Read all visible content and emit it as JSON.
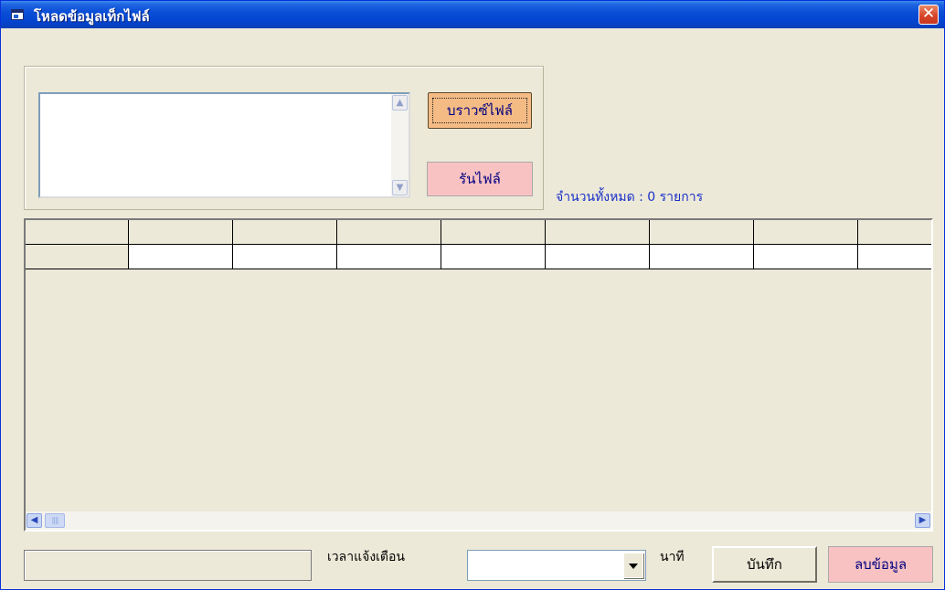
{
  "window": {
    "title": "โหลดข้อมูลเท็กไฟล์",
    "close_glyph": "✕",
    "title_icon": "form-icon"
  },
  "file_panel": {
    "file_text_value": "",
    "scroll_up_glyph": "▲",
    "scroll_down_glyph": "▼",
    "browse_label": "บราวซ์ไฟล์",
    "run_label": "รันไฟล์"
  },
  "summary": {
    "count_text": "จำนวนทั้งหมด : 0 รายการ"
  },
  "grid": {
    "column_count": 9,
    "row_count": 2,
    "hscroll_left_glyph": "◀",
    "hscroll_right_glyph": "▶",
    "hscroll_thumb_glyph": "||||"
  },
  "footer": {
    "status_text": "",
    "alert_time_label": "เวลาแจ้งเตือน",
    "alert_time_value": "",
    "minutes_label": "นาที",
    "save_label": "บันทึก",
    "delete_label": "ลบข้อมูล"
  },
  "colors": {
    "titlebar": "#0a4fd8",
    "window_bg": "#ece9d8",
    "browse_button": "#f5bb85",
    "pink_button": "#f9c2c2",
    "count_text": "#1830c8",
    "close_button": "#d8452a"
  }
}
